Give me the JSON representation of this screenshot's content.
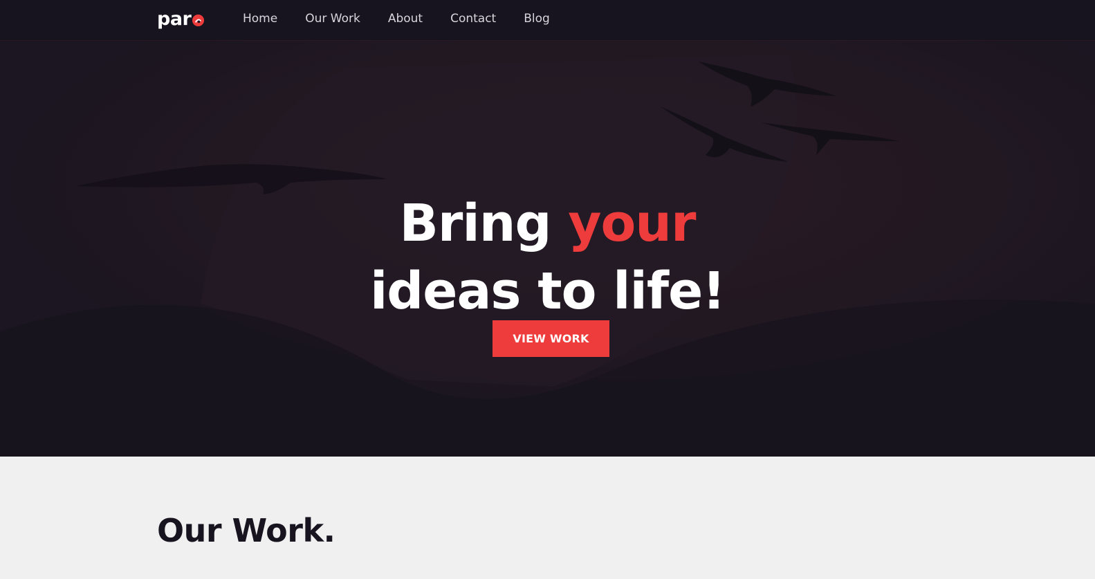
{
  "nav": {
    "logo_text": "par",
    "links": [
      {
        "label": "Home"
      },
      {
        "label": "Our Work"
      },
      {
        "label": "About"
      },
      {
        "label": "Contact"
      },
      {
        "label": "Blog"
      }
    ]
  },
  "hero": {
    "title_part1": "Bring ",
    "title_accent": "your",
    "title_line2": "ideas to life!",
    "button_label": "VIEW WORK"
  },
  "section": {
    "title": "Our Work."
  },
  "colors": {
    "accent": "#ee3b3b",
    "dark": "#17141f",
    "light": "#f0f0f0"
  },
  "icons": {
    "logo_mark": "red-circle-logo-icon",
    "hero_background": "birds-silhouette-background"
  }
}
